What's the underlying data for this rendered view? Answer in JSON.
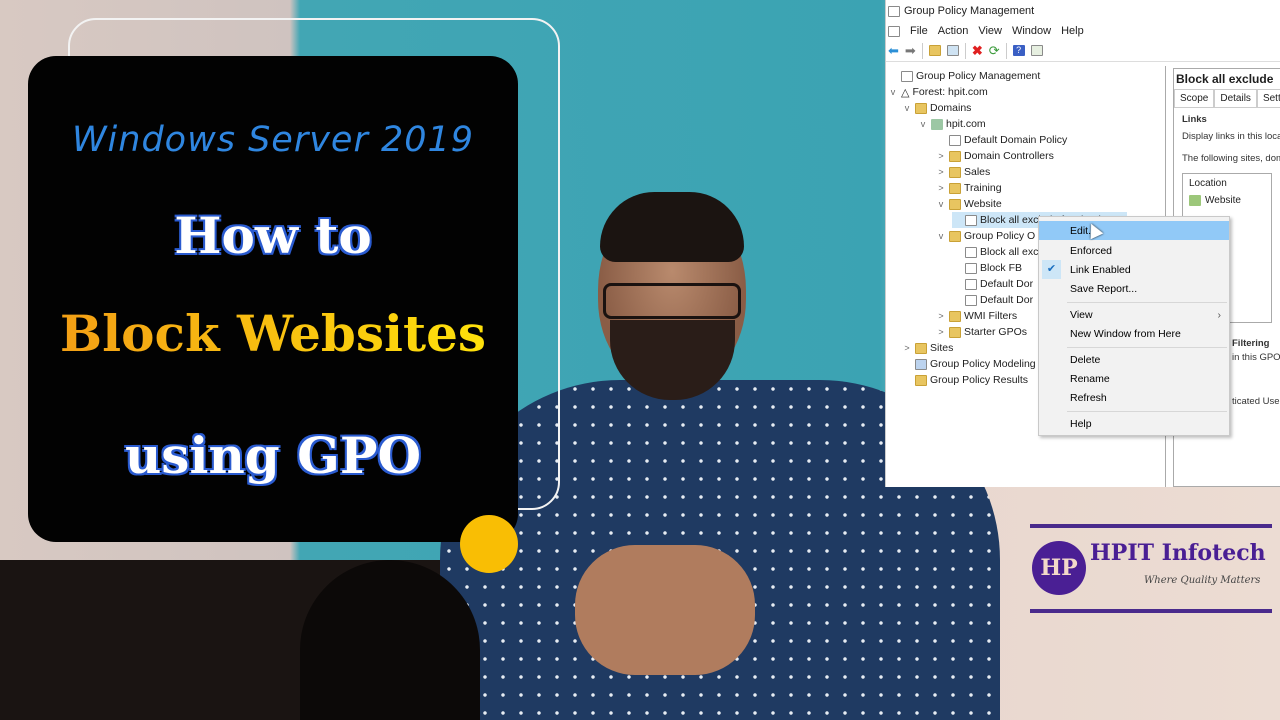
{
  "thumbnail": {
    "subtitle": "Windows Server 2019",
    "line1": "How to",
    "line2": "Block Websites",
    "line3": "using GPO",
    "accent_colors": {
      "subtitle": "#2f86e0",
      "block": "#f29a16",
      "dot": "#f9be04"
    }
  },
  "window": {
    "title": "Group Policy Management",
    "menu": [
      "File",
      "Action",
      "View",
      "Window",
      "Help"
    ],
    "toolbar_icons": [
      "back-icon",
      "forward-icon",
      "up-folder-icon",
      "show-hide-tree-icon",
      "delete-icon",
      "refresh-icon",
      "help-icon",
      "properties-icon"
    ]
  },
  "tree": [
    {
      "label": "Group Policy Management",
      "icon": "gpm-icon",
      "expand": ""
    },
    {
      "label": "Forest: hpit.com",
      "icon": "forest-icon",
      "expand": "v"
    },
    {
      "label": "Domains",
      "icon": "domains-icon",
      "expand": "v"
    },
    {
      "label": "hpit.com",
      "icon": "domain-icon",
      "expand": "v"
    },
    {
      "label": "Default Domain Policy",
      "icon": "gpo-link-icon",
      "expand": ""
    },
    {
      "label": "Domain Controllers",
      "icon": "ou-icon",
      "expand": ">"
    },
    {
      "label": "Sales",
      "icon": "ou-icon",
      "expand": ">"
    },
    {
      "label": "Training",
      "icon": "ou-icon",
      "expand": ">"
    },
    {
      "label": "Website",
      "icon": "ou-icon",
      "expand": "v"
    },
    {
      "label": "Block all exclude facebook",
      "icon": "gpo-link-icon",
      "expand": ""
    },
    {
      "label": "Group Policy O",
      "icon": "gpo-container-icon",
      "expand": "v"
    },
    {
      "label": "Block all exc",
      "icon": "gpo-icon",
      "expand": ""
    },
    {
      "label": "Block FB",
      "icon": "gpo-icon",
      "expand": ""
    },
    {
      "label": "Default Dor",
      "icon": "gpo-icon",
      "expand": ""
    },
    {
      "label": "Default Dor",
      "icon": "gpo-icon",
      "expand": ""
    },
    {
      "label": "WMI Filters",
      "icon": "wmi-icon",
      "expand": ">"
    },
    {
      "label": "Starter GPOs",
      "icon": "starter-icon",
      "expand": ">"
    },
    {
      "label": "Sites",
      "icon": "sites-icon",
      "expand": ">"
    },
    {
      "label": "Group Policy Modeling",
      "icon": "modeling-icon",
      "expand": ""
    },
    {
      "label": "Group Policy Results",
      "icon": "results-icon",
      "expand": ""
    }
  ],
  "details": {
    "title": "Block all exclude",
    "tabs": [
      "Scope",
      "Details",
      "Settin"
    ],
    "links_heading": "Links",
    "links_desc": "Display links in this locat",
    "following": "The following sites, dom",
    "location_header": "Location",
    "location_row": "Website",
    "filtering_heading": "Filtering",
    "filtering_desc": "in this GPO",
    "auth_users": "ticated Use"
  },
  "context_menu": {
    "items": [
      {
        "label": "Edit...",
        "highlighted": true
      },
      {
        "label": "Enforced"
      },
      {
        "label": "Link Enabled",
        "checked": true
      },
      {
        "label": "Save Report..."
      },
      {
        "label": "View",
        "submenu": true
      },
      {
        "label": "New Window from Here"
      },
      {
        "label": "Delete"
      },
      {
        "label": "Rename"
      },
      {
        "label": "Refresh"
      },
      {
        "label": "Help"
      }
    ],
    "submenu_arrow": "›",
    "check_mark": "✔"
  },
  "logo": {
    "monogram": "HP",
    "name": "HPIT Infotech",
    "tagline": "Where Quality Matters",
    "color": "#4a1f94"
  }
}
